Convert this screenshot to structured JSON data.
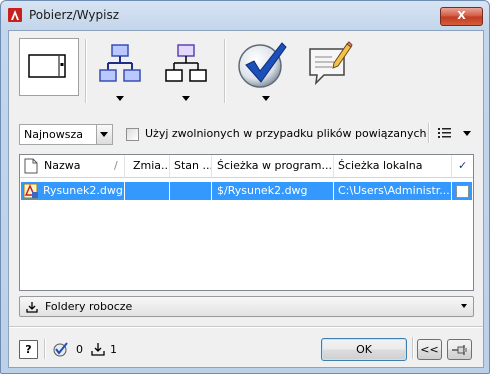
{
  "window": {
    "title": "Pobierz/Wypisz",
    "close_label": "X"
  },
  "toolbar": {
    "buttons": [
      {
        "name": "select-files-button",
        "icon": "window-layout-icon"
      },
      {
        "name": "file-tree-dropdown",
        "icon": "hierarchy-icon"
      },
      {
        "name": "file-tree-outline-dropdown",
        "icon": "hierarchy-outline-icon"
      },
      {
        "name": "check-in-dropdown",
        "icon": "checkmark-icon"
      },
      {
        "name": "comment-button",
        "icon": "comment-pencil-icon"
      }
    ]
  },
  "filter": {
    "version_select": "Najnowsza",
    "use_released_label": "Użyj zwolnionych w przypadku plików powiązanych",
    "use_released_checked": false
  },
  "table": {
    "columns": [
      "Nazwa",
      "Zmia...",
      "Stan ...",
      "Ścieżka w program...",
      "Ścieżka lokalna",
      "✓"
    ],
    "rows": [
      {
        "name": "Rysunek2.dwg",
        "changed": "",
        "state": "",
        "vault_path": "$/Rysunek2.dwg",
        "local_path": "C:\\Users\\Administr...",
        "checked": false,
        "selected": true
      }
    ]
  },
  "workspace": {
    "label": "Foldery robocze"
  },
  "status": {
    "help_label": "?",
    "checked_count": "0",
    "download_count": "1"
  },
  "buttons": {
    "ok": "OK",
    "collapse": "<<"
  },
  "colors": {
    "selection": "#3399ff",
    "title_bar": "#c4d6ec",
    "close": "#c13a21"
  }
}
